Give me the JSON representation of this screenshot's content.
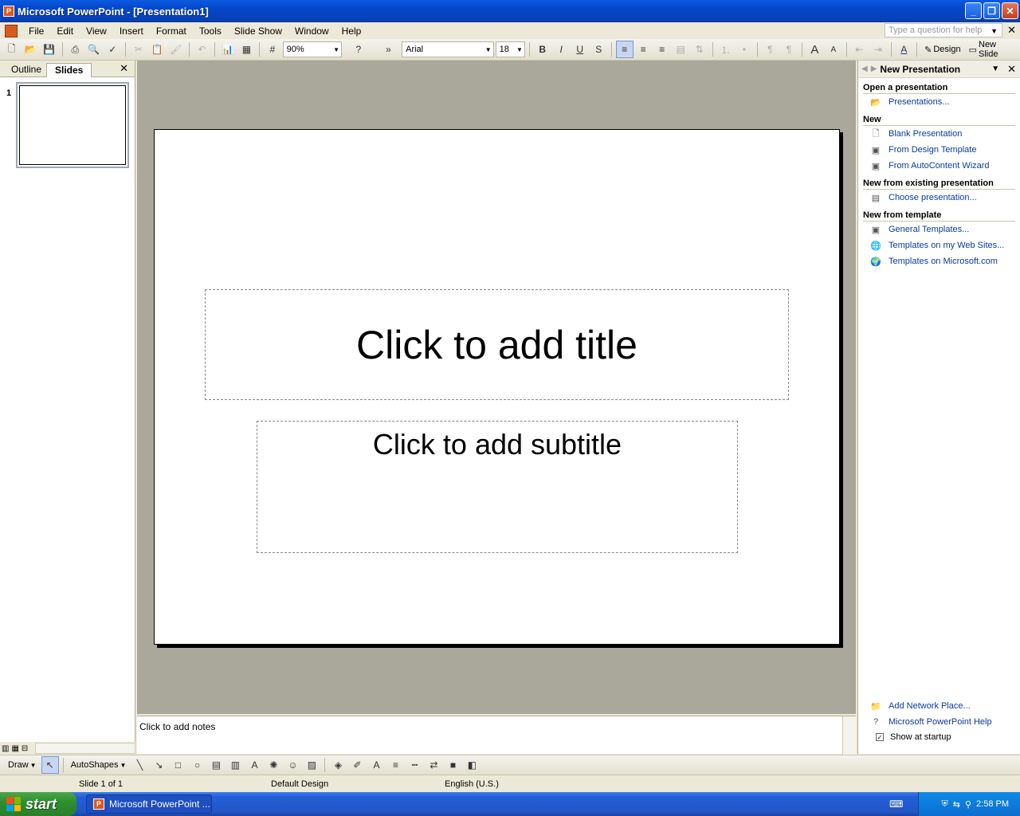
{
  "window": {
    "title": "Microsoft PowerPoint - [Presentation1]"
  },
  "menu": [
    "File",
    "Edit",
    "View",
    "Insert",
    "Format",
    "Tools",
    "Slide Show",
    "Window",
    "Help"
  ],
  "help_box": {
    "placeholder": "Type a question for help"
  },
  "toolbar": {
    "zoom": "90%",
    "font": "Arial",
    "font_size": "18",
    "design_label": "Design",
    "new_slide_label": "New Slide"
  },
  "left_pane": {
    "tabs": [
      "Outline",
      "Slides"
    ],
    "active_tab": "Slides",
    "slide_number": "1"
  },
  "slide": {
    "title_placeholder": "Click to add title",
    "subtitle_placeholder": "Click to add subtitle"
  },
  "notes": {
    "placeholder": "Click to add notes"
  },
  "task_pane": {
    "title": "New Presentation",
    "sections": [
      {
        "heading": "Open a presentation",
        "links": [
          {
            "label": "Presentations...",
            "icon": "folder-icon"
          }
        ]
      },
      {
        "heading": "New",
        "links": [
          {
            "label": "Blank Presentation",
            "icon": "blank-doc-icon"
          },
          {
            "label": "From Design Template",
            "icon": "design-template-icon"
          },
          {
            "label": "From AutoContent Wizard",
            "icon": "wizard-icon"
          }
        ]
      },
      {
        "heading": "New from existing presentation",
        "links": [
          {
            "label": "Choose presentation...",
            "icon": "presentation-icon"
          }
        ]
      },
      {
        "heading": "New from template",
        "links": [
          {
            "label": "General Templates...",
            "icon": "template-icon"
          },
          {
            "label": "Templates on my Web Sites...",
            "icon": "web-folder-icon"
          },
          {
            "label": "Templates on Microsoft.com",
            "icon": "globe-icon"
          }
        ]
      }
    ],
    "footer": {
      "add_network_place": "Add Network Place...",
      "help": "Microsoft PowerPoint Help",
      "show_at_startup": "Show at startup"
    }
  },
  "drawing": {
    "draw_label": "Draw",
    "autoshapes_label": "AutoShapes"
  },
  "status": {
    "slide_info": "Slide 1 of 1",
    "design": "Default Design",
    "language": "English (U.S.)"
  },
  "taskbar": {
    "start_label": "start",
    "task_label": "Microsoft PowerPoint ...",
    "time": "2:58 PM"
  },
  "colors": {
    "titlebar": "#0a5ae0",
    "canvas": "#aaa89a",
    "link": "#0b3a9c",
    "start": "#2f8f2f"
  }
}
